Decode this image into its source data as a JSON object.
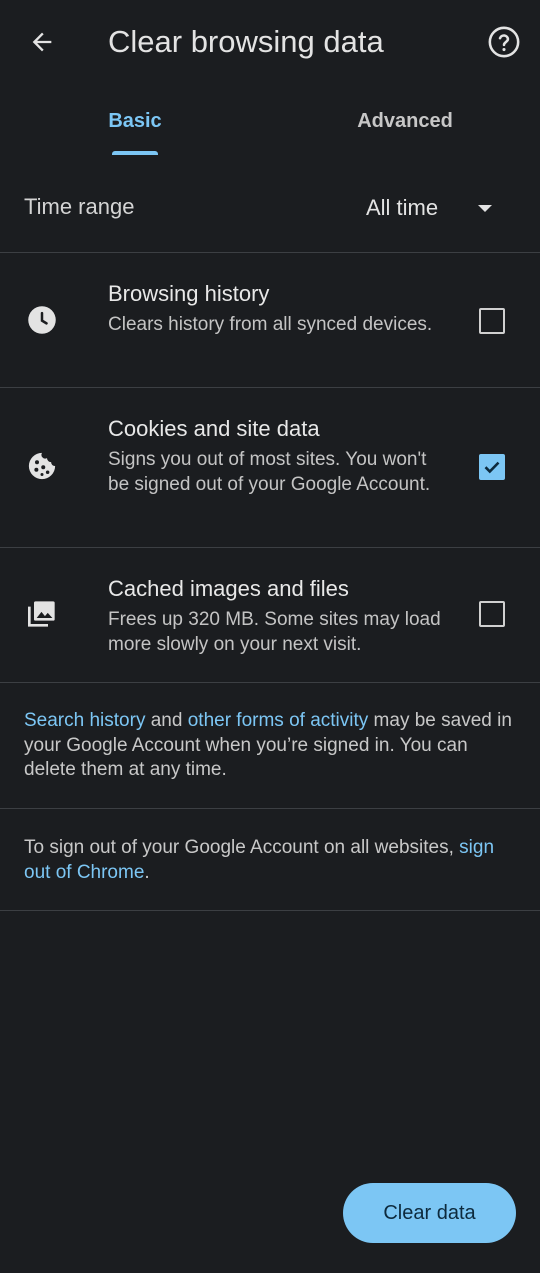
{
  "header": {
    "title": "Clear browsing data",
    "back_icon": "arrow-back-icon",
    "help_icon": "help-icon"
  },
  "tabs": [
    {
      "label": "Basic",
      "selected": true
    },
    {
      "label": "Advanced",
      "selected": false
    }
  ],
  "time_range": {
    "label": "Time range",
    "value": "All time"
  },
  "options": [
    {
      "title": "Browsing history",
      "description": "Clears history from all synced devices.",
      "icon": "clock-icon",
      "checked": false
    },
    {
      "title": "Cookies and site data",
      "description": "Signs you out of most sites. You won't be signed out of your Google Account.",
      "icon": "cookie-icon",
      "checked": true
    },
    {
      "title": "Cached images and files",
      "description": "Frees up 320 MB. Some sites may load more slowly on your next visit.",
      "icon": "image-icon",
      "checked": false
    }
  ],
  "info": {
    "link1": "Search history",
    "and": " and ",
    "link2": "other forms of activity",
    "rest": " may be saved in your Google Account when you’re signed in. You can delete them at any time."
  },
  "signout": {
    "text": "To sign out of your Google Account on all websites, ",
    "link": "sign out of Chrome",
    "end": "."
  },
  "footer": {
    "clear_button": "Clear data"
  },
  "colors": {
    "accent": "#7cc6f4",
    "background": "#1b1d20",
    "divider": "#3c3f43"
  }
}
